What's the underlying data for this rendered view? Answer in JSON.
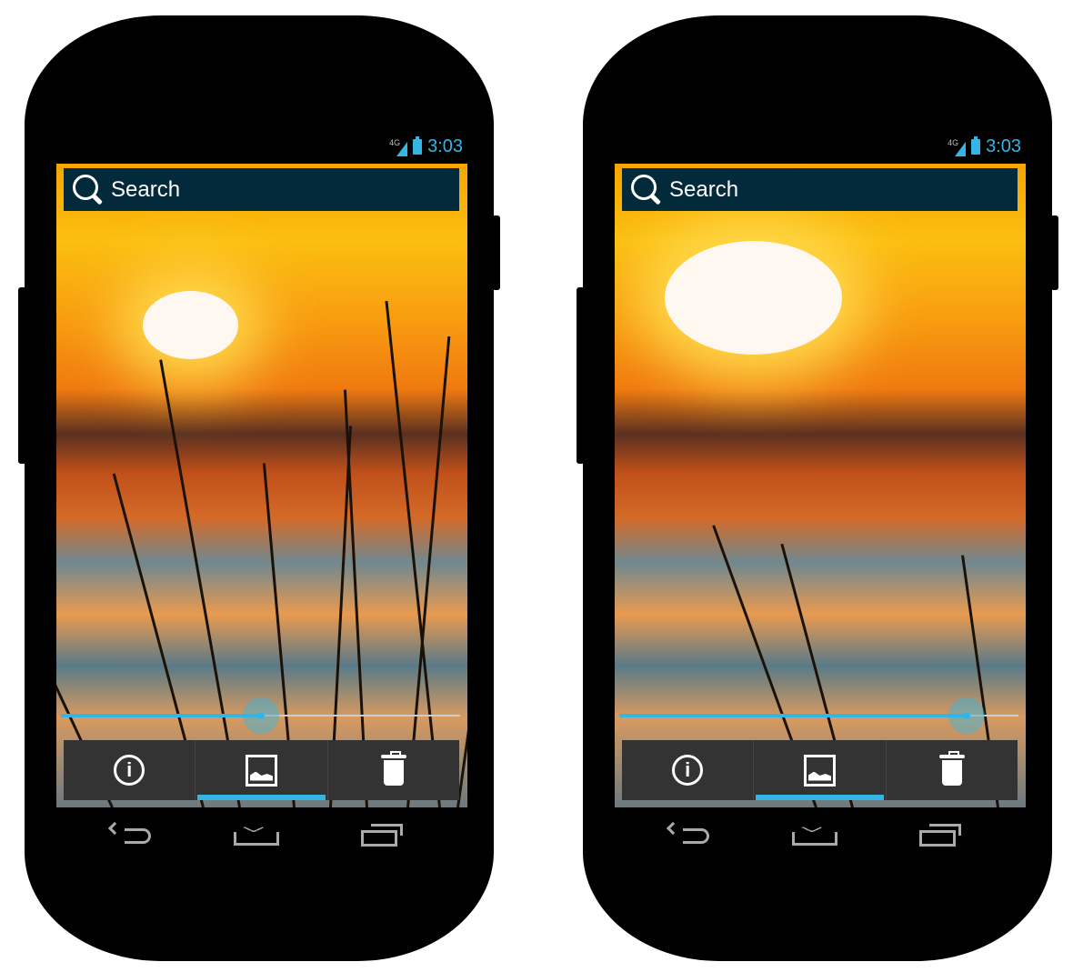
{
  "accent": "#33b5e5",
  "phones": [
    {
      "status": {
        "network": "4G",
        "time": "3:03"
      },
      "search": {
        "placeholder": "Search",
        "icon": "search-icon"
      },
      "slider": {
        "value_percent": 50
      },
      "tabs": [
        {
          "icon": "info-icon"
        },
        {
          "icon": "image-icon",
          "selected": true
        },
        {
          "icon": "trash-icon"
        }
      ],
      "nav": [
        "back-icon",
        "home-icon",
        "recents-icon"
      ]
    },
    {
      "status": {
        "network": "4G",
        "time": "3:03"
      },
      "search": {
        "placeholder": "Search",
        "icon": "search-icon"
      },
      "slider": {
        "value_percent": 87
      },
      "tabs": [
        {
          "icon": "info-icon"
        },
        {
          "icon": "image-icon",
          "selected": true
        },
        {
          "icon": "trash-icon"
        }
      ],
      "nav": [
        "back-icon",
        "home-icon",
        "recents-icon"
      ]
    }
  ]
}
